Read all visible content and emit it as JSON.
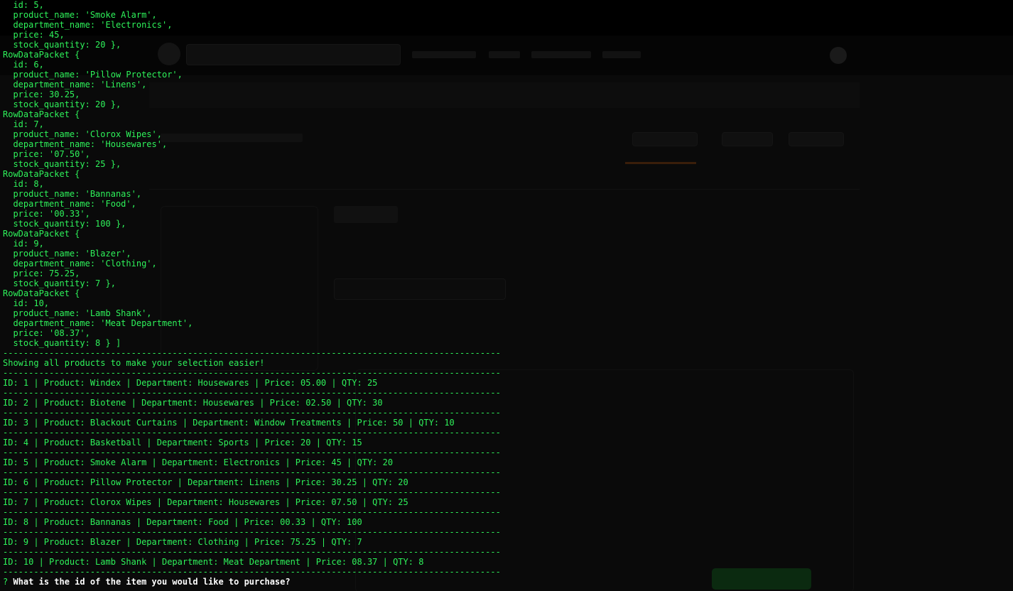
{
  "terminal": {
    "lines": [
      "  id: 5,",
      "  product_name: 'Smoke Alarm',",
      "  department_name: 'Electronics',",
      "  price: 45,",
      "  stock_quantity: 20 },",
      "RowDataPacket {",
      "  id: 6,",
      "  product_name: 'Pillow Protector',",
      "  department_name: 'Linens',",
      "  price: 30.25,",
      "  stock_quantity: 20 },",
      "RowDataPacket {",
      "  id: 7,",
      "  product_name: 'Clorox Wipes',",
      "  department_name: 'Housewares',",
      "  price: '07.50',",
      "  stock_quantity: 25 },",
      "RowDataPacket {",
      "  id: 8,",
      "  product_name: 'Bannanas',",
      "  department_name: 'Food',",
      "  price: '00.33',",
      "  stock_quantity: 100 },",
      "RowDataPacket {",
      "  id: 9,",
      "  product_name: 'Blazer',",
      "  department_name: 'Clothing',",
      "  price: 75.25,",
      "  stock_quantity: 7 },",
      "RowDataPacket {",
      "  id: 10,",
      "  product_name: 'Lamb Shank',",
      "  department_name: 'Meat Department',",
      "  price: '08.37',",
      "  stock_quantity: 8 } ]",
      "-------------------------------------------------------------------------------------------------",
      "Showing all products to make your selection easier!",
      "-------------------------------------------------------------------------------------------------",
      "ID: 1 | Product: Windex | Department: Housewares | Price: 05.00 | QTY: 25",
      "-------------------------------------------------------------------------------------------------",
      "ID: 2 | Product: Biotene | Department: Housewares | Price: 02.50 | QTY: 30",
      "-------------------------------------------------------------------------------------------------",
      "ID: 3 | Product: Blackout Curtains | Department: Window Treatments | Price: 50 | QTY: 10",
      "-------------------------------------------------------------------------------------------------",
      "ID: 4 | Product: Basketball | Department: Sports | Price: 20 | QTY: 15",
      "-------------------------------------------------------------------------------------------------",
      "ID: 5 | Product: Smoke Alarm | Department: Electronics | Price: 45 | QTY: 20",
      "-------------------------------------------------------------------------------------------------",
      "ID: 6 | Product: Pillow Protector | Department: Linens | Price: 30.25 | QTY: 20",
      "-------------------------------------------------------------------------------------------------",
      "ID: 7 | Product: Clorox Wipes | Department: Housewares | Price: 07.50 | QTY: 25",
      "-------------------------------------------------------------------------------------------------",
      "ID: 8 | Product: Bannanas | Department: Food | Price: 00.33 | QTY: 100",
      "-------------------------------------------------------------------------------------------------",
      "ID: 9 | Product: Blazer | Department: Clothing | Price: 75.25 | QTY: 7",
      "-------------------------------------------------------------------------------------------------",
      "ID: 10 | Product: Lamb Shank | Department: Meat Department | Price: 08.37 | QTY: 8",
      "-------------------------------------------------------------------------------------------------"
    ],
    "prompt": {
      "marker": "?",
      "question": "What is the id of the item you would like to purchase?"
    }
  }
}
